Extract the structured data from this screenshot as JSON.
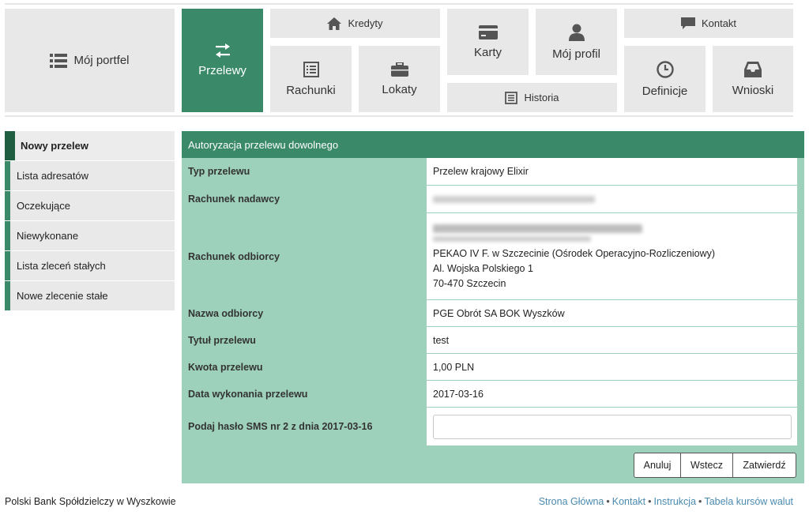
{
  "nav": {
    "portfolio": "Mój portfel",
    "transfers": "Przelewy",
    "credits": "Kredyty",
    "accounts": "Rachunki",
    "deposits": "Lokaty",
    "cards": "Karty",
    "history": "Historia",
    "profile": "Mój profil",
    "contact": "Kontakt",
    "definitions": "Definicje",
    "applications": "Wnioski",
    "active_color": "#3a8a6a"
  },
  "sidebar": {
    "items": [
      {
        "label": "Nowy przelew"
      },
      {
        "label": "Lista adresatów"
      },
      {
        "label": "Oczekujące"
      },
      {
        "label": "Niewykonane"
      },
      {
        "label": "Lista zleceń stałych"
      },
      {
        "label": "Nowe zlecenie stałe"
      }
    ]
  },
  "form": {
    "title": "Autoryzacja przelewu dowolnego",
    "type_label": "Typ przelewu",
    "type_value": "Przelew krajowy Elixir",
    "sender_label": "Rachunek nadawcy",
    "recipient_account_label": "Rachunek odbiorcy",
    "recipient_bank_line1": "PEKAO IV F. w Szczecinie (Ośrodek Operacyjno-Rozliczeniowy)",
    "recipient_bank_line2": "Al. Wojska Polskiego 1",
    "recipient_bank_line3": "70-470 Szczecin",
    "recipient_name_label": "Nazwa odbiorcy",
    "recipient_name_value": "PGE Obrót SA BOK Wyszków",
    "title_label": "Tytuł przelewu",
    "title_value": "test",
    "amount_label": "Kwota przelewu",
    "amount_value": "1,00 PLN",
    "date_label": "Data wykonania przelewu",
    "date_value": "2017-03-16",
    "sms_label": "Podaj hasło SMS nr 2 z dnia 2017-03-16",
    "sms_value": ""
  },
  "buttons": {
    "cancel": "Anuluj",
    "back": "Wstecz",
    "confirm": "Zatwierdź"
  },
  "footer": {
    "bank_name": "Polski Bank Spółdzielczy w Wyszkowie",
    "links": [
      "Strona Główna",
      "Kontakt",
      "Instrukcja",
      "Tabela kursów walut"
    ],
    "separator": "•"
  }
}
